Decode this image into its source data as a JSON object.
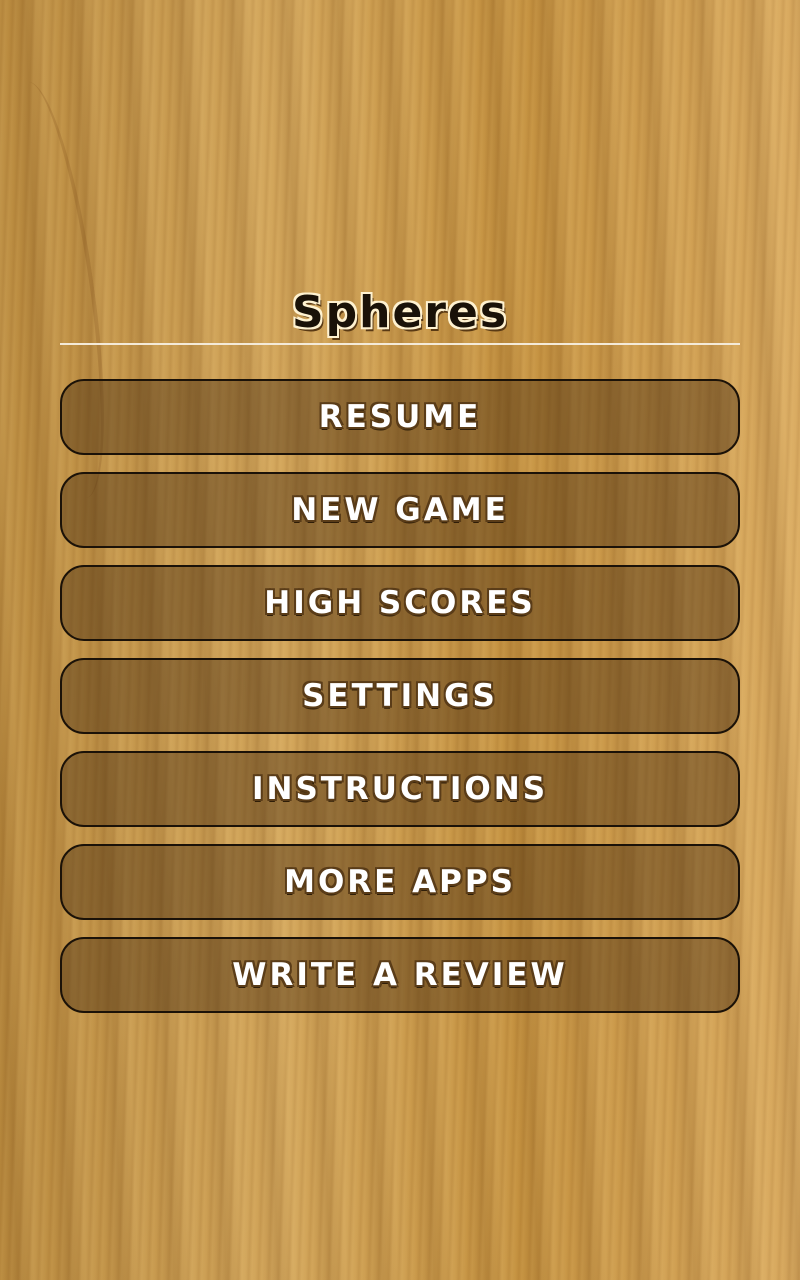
{
  "app": {
    "title": "Spheres"
  },
  "menu": {
    "items": [
      {
        "label": "RESUME"
      },
      {
        "label": "NEW GAME"
      },
      {
        "label": "HIGH SCORES"
      },
      {
        "label": "SETTINGS"
      },
      {
        "label": "INSTRUCTIONS"
      },
      {
        "label": "MORE APPS"
      },
      {
        "label": "WRITE A REVIEW"
      }
    ]
  },
  "colors": {
    "background": "#c99a4e",
    "button_border": "#1b1208",
    "button_text": "#ffffff",
    "divider": "#f4ead8"
  }
}
